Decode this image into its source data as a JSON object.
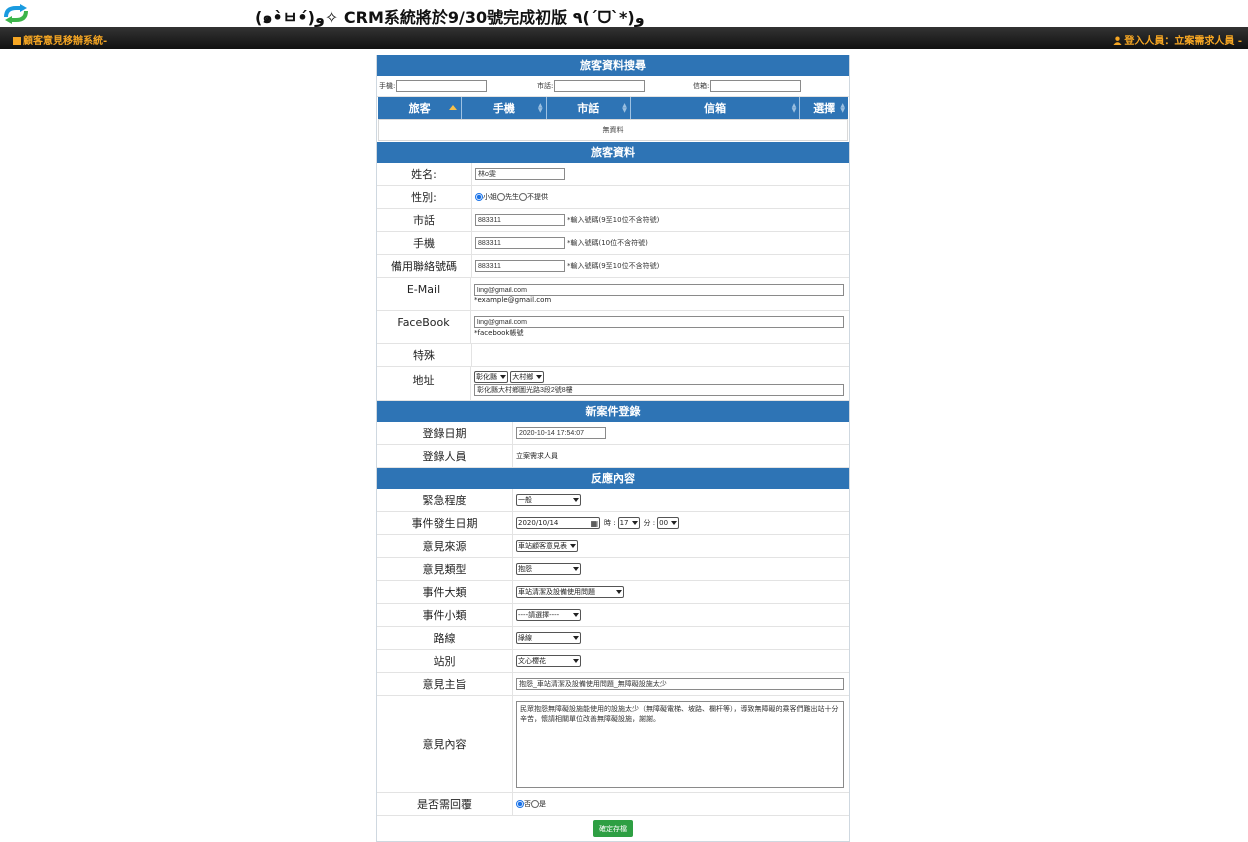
{
  "announcement": "(๑•̀ㅂ•́)و✧ CRM系統將於9/30號完成初版 ٩(ˊᗜˋ*)و",
  "header": {
    "system_title": "顧客意見移辦系統-",
    "user_label": "登入人員：立案需求人員 -"
  },
  "search": {
    "title": "旅客資料搜尋",
    "mobile_label": "手機:",
    "mobile_value": "",
    "phone_label": "市話:",
    "phone_value": "",
    "email_label": "信箱:",
    "email_value": "",
    "columns": [
      "旅客",
      "手機",
      "市話",
      "信箱",
      "選擇"
    ],
    "no_records": "無資料"
  },
  "passenger": {
    "title": "旅客資料",
    "name_label": "姓名:",
    "name_value": "林o雯",
    "gender_label": "性別:",
    "gender_options": [
      "小姐",
      "先生",
      "不提供"
    ],
    "gender_selected": "小姐",
    "phone_label": "市話",
    "phone_value": "883311",
    "phone_hint": "*輸入號碼(9至10位不含符號)",
    "mobile_label": "手機",
    "mobile_value": "883311",
    "mobile_hint": "*輸入號碼(10位不含符號)",
    "backup_label": "備用聯絡號碼",
    "backup_value": "883311",
    "backup_hint": "*輸入號碼(9至10位不含符號)",
    "email_label": "E-Mail",
    "email_value": "ling@gmail.com",
    "email_hint": "*example@gmail.com",
    "facebook_label": "FaceBook",
    "facebook_value": "ling@gmail.com",
    "facebook_hint": "*facebook帳號",
    "special_label": "特殊",
    "address_label": "地址",
    "county": "彰化縣",
    "township": "大村鄉",
    "address_value": "彰化縣大村鄉圖光路3段2號8樓"
  },
  "new_case": {
    "title": "新案件登錄",
    "date_label": "登錄日期",
    "date_value": "2020-10-14 17:54:07",
    "staff_label": "登錄人員",
    "staff_value": "立案需求人員"
  },
  "feedback": {
    "title": "反應內容",
    "urgency_label": "緊急程度",
    "urgency_value": "一般",
    "event_date_label": "事件發生日期",
    "event_date_value": "2020/10/14",
    "hour_label": "時 :",
    "hour_value": "17",
    "minute_label": "分 :",
    "minute_value": "00",
    "source_label": "意見來源",
    "source_value": "車站顧客意見表",
    "type_label": "意見類型",
    "type_value": "抱怨",
    "category_label": "事件大類",
    "category_value": "車站清潔及設備使用問題",
    "subcategory_label": "事件小類",
    "subcategory_value": "----請選擇----",
    "line_label": "路線",
    "line_value": "綠線",
    "station_label": "站別",
    "station_value": "文心櫻花",
    "subject_label": "意見主旨",
    "subject_value": "抱怨_車站清潔及設備使用問題_無障礙設施太少",
    "content_label": "意見內容",
    "content_value": "民眾抱怨無障礙設施能使用的設施太少（無障礙電梯、坡路、欄杆等），導致無障礙的乘客們難出站十分辛苦，懷請相關單位改善無障礙設施，謝謝。",
    "reply_label": "是否需回覆",
    "reply_options": [
      "否",
      "是"
    ],
    "reply_selected": "否"
  },
  "submit_label": "確定存檔",
  "colors": {
    "accent": "#2e74b5",
    "header_text": "#f6a623",
    "submit": "#2e9f43"
  }
}
